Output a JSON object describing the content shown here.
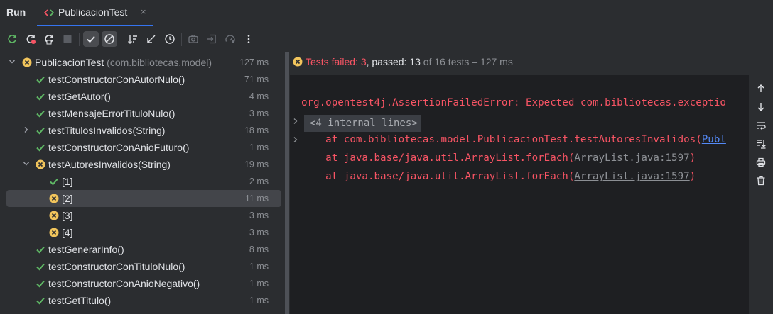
{
  "header": {
    "run_title": "Run",
    "tab_label": "PublicacionTest",
    "tab_close": "×"
  },
  "toolbar": {
    "icons": [
      "rerun-icon",
      "rerun-failed-icon",
      "rerun-toggle-icon",
      "stop-icon",
      "show-passed-icon",
      "show-ignored-icon",
      "sort-alpha-icon",
      "sort-duration-icon",
      "history-icon",
      "screenshot-icon",
      "import-icon",
      "coverage-icon",
      "more-icon"
    ]
  },
  "tree": {
    "root": {
      "label": "PublicacionTest",
      "package": "(com.bibliotecas.model)",
      "duration": "127 ms"
    },
    "items": [
      {
        "label": "testConstructorConAutorNulo()",
        "duration": "71 ms",
        "status": "passed"
      },
      {
        "label": "testGetAutor()",
        "duration": "4 ms",
        "status": "passed"
      },
      {
        "label": "testMensajeErrorTituloNulo()",
        "duration": "3 ms",
        "status": "passed"
      },
      {
        "label": "testTitulosInvalidos(String)",
        "duration": "18 ms",
        "status": "passed"
      },
      {
        "label": "testConstructorConAnioFuturo()",
        "duration": "1 ms",
        "status": "passed"
      },
      {
        "label": "testAutoresInvalidos(String)",
        "duration": "19 ms",
        "status": "failed"
      },
      {
        "label": "[1]",
        "duration": "2 ms",
        "status": "passed"
      },
      {
        "label": "[2]",
        "duration": "11 ms",
        "status": "failed"
      },
      {
        "label": "[3]",
        "duration": "3 ms",
        "status": "failed"
      },
      {
        "label": "[4]",
        "duration": "3 ms",
        "status": "failed"
      },
      {
        "label": "testGenerarInfo()",
        "duration": "8 ms",
        "status": "passed"
      },
      {
        "label": "testConstructorConTituloNulo()",
        "duration": "1 ms",
        "status": "passed"
      },
      {
        "label": "testConstructorConAnioNegativo()",
        "duration": "1 ms",
        "status": "passed"
      },
      {
        "label": "testGetTitulo()",
        "duration": "1 ms",
        "status": "passed"
      }
    ]
  },
  "status": {
    "failed_text": "Tests failed: 3",
    "passed_text": ", passed: 13",
    "rest_text": " of 16 tests – 127 ms"
  },
  "console": {
    "error_line": "org.opentest4j.AssertionFailedError: Expected com.bibliotecas.exceptio",
    "folded": "<4 internal lines>",
    "trace1_prefix": "    at com.bibliotecas.model.PublicacionTest.testAutoresInvalidos(",
    "trace1_link": "Publ",
    "trace2_prefix": "    at java.base/java.util.ArrayList.forEach(",
    "trace2_link": "ArrayList.java:1597",
    "trace2_suffix": ")",
    "trace3_prefix": "    at java.base/java.util.ArrayList.forEach(",
    "trace3_link": "ArrayList.java:1597",
    "trace3_suffix": ")"
  },
  "colors": {
    "passed": "#5fb865",
    "failed": "#f2c55c",
    "error_text": "#f75464",
    "accent": "#3574f0"
  }
}
